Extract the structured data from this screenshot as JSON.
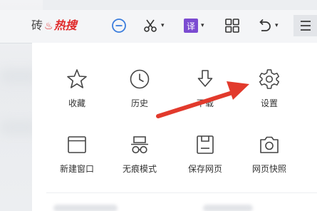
{
  "toolbar": {
    "partial_text": "砖",
    "hot_search_label": "热搜",
    "translate_label": "译"
  },
  "menu": {
    "items": [
      {
        "label": "收藏"
      },
      {
        "label": "历史"
      },
      {
        "label": "下载"
      },
      {
        "label": "设置"
      },
      {
        "label": "新建窗口"
      },
      {
        "label": "无痕模式"
      },
      {
        "label": "保存网页"
      },
      {
        "label": "网页快照"
      }
    ]
  },
  "colors": {
    "accent_blue": "#3b7ddd",
    "hot_red": "#e02b2b",
    "translate_purple": "#7b4bd1",
    "arrow_red": "#e23a2c"
  },
  "icons": [
    "minus-circle-icon",
    "scissors-icon",
    "translate-icon",
    "grid-icon",
    "undo-icon",
    "menu-icon",
    "star-icon",
    "clock-icon",
    "download-icon",
    "gear-icon",
    "window-icon",
    "incognito-glasses-icon",
    "save-icon",
    "camera-icon"
  ]
}
